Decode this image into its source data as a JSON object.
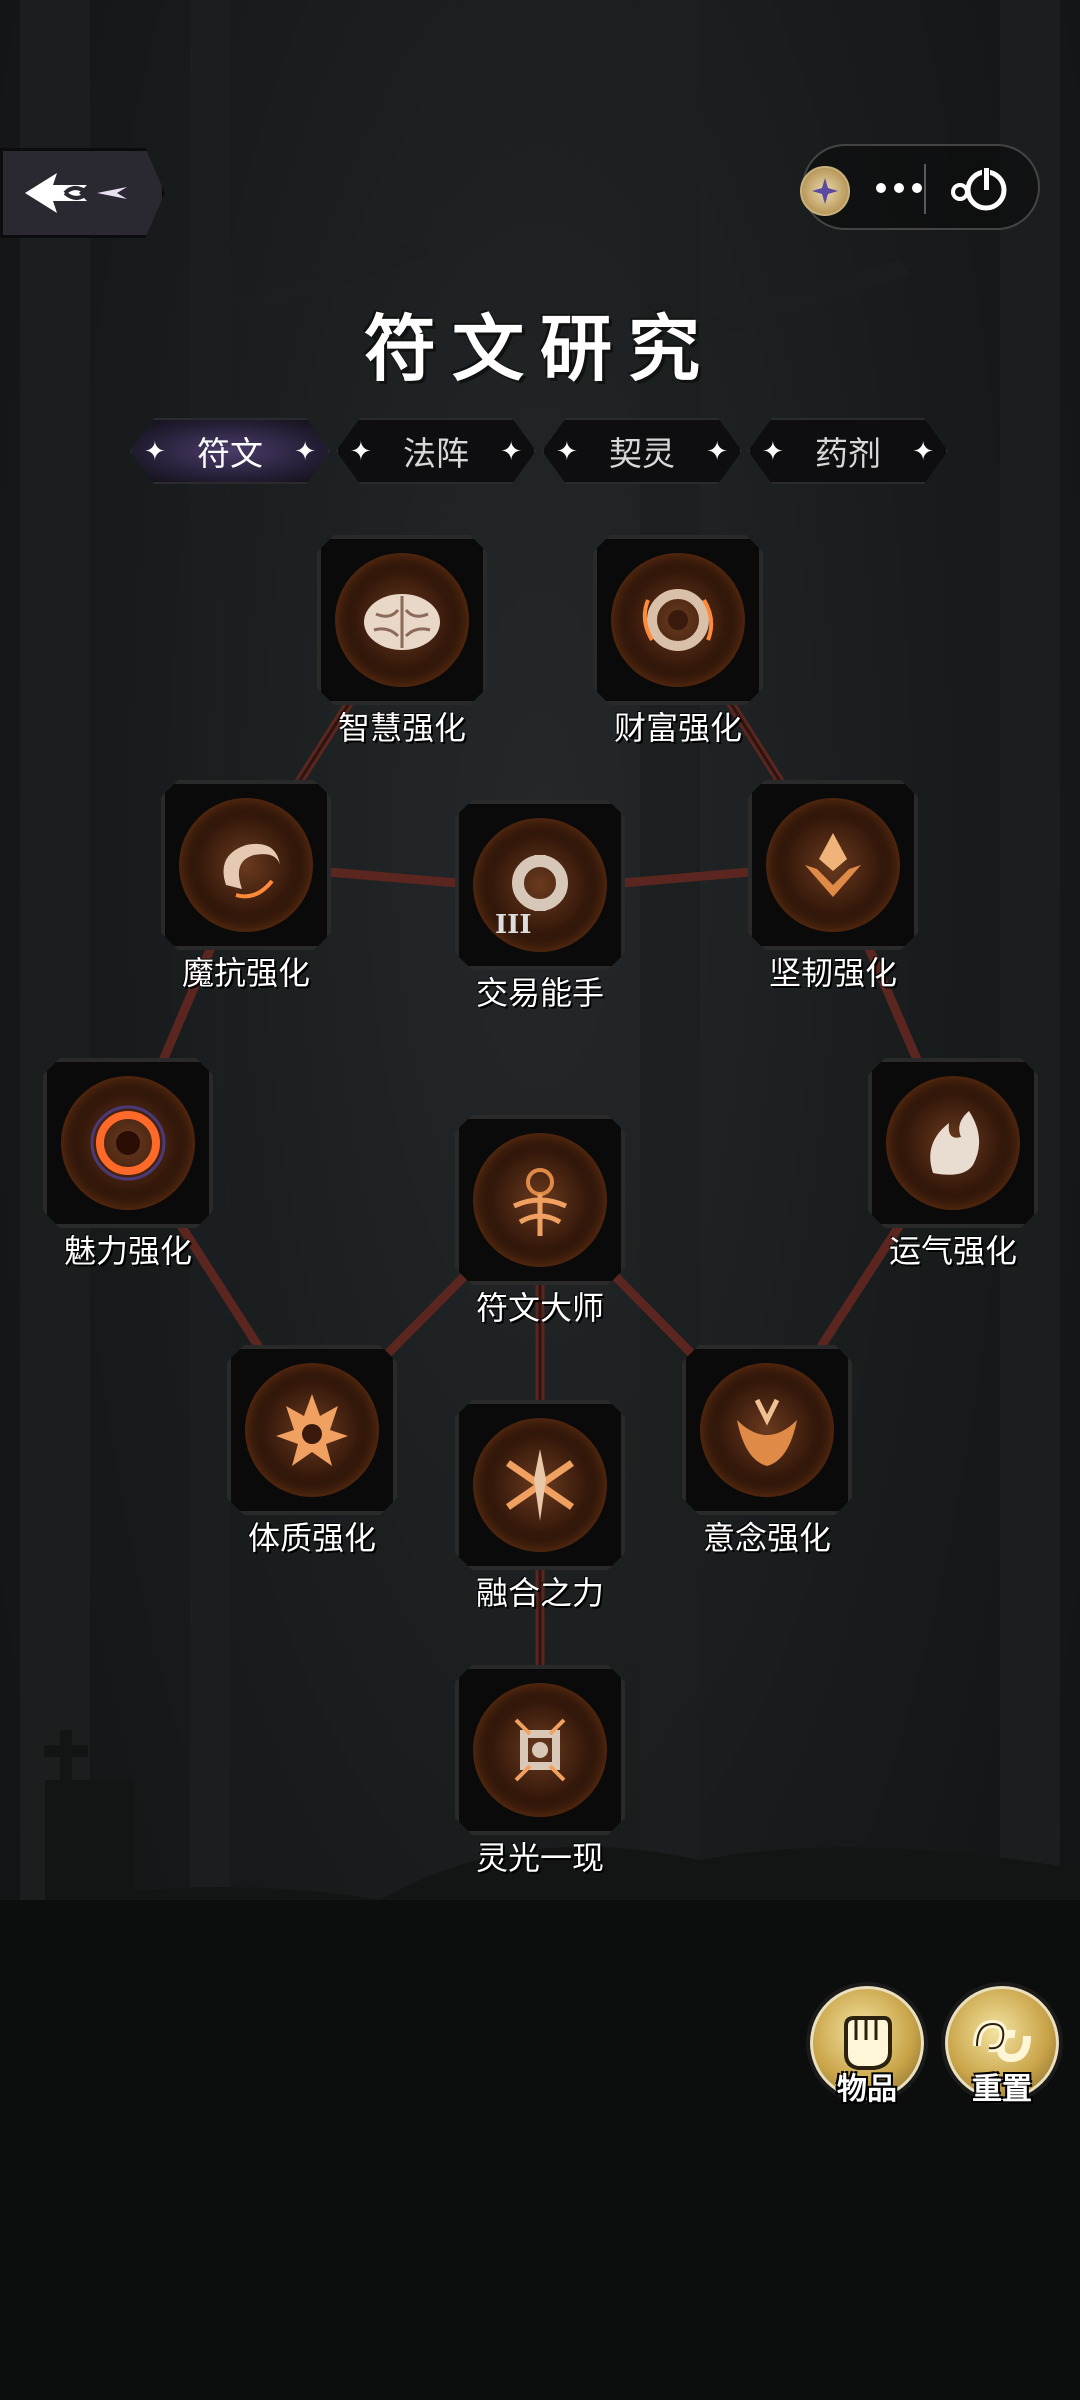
{
  "header": {
    "title": "符文研究",
    "back_icon": "back-arrow-icon",
    "capsule": {
      "more_icon": "more-dots-icon",
      "close_icon": "power-icon"
    }
  },
  "tabs": [
    {
      "label": "符文",
      "active": true
    },
    {
      "label": "法阵",
      "active": false
    },
    {
      "label": "契灵",
      "active": false
    },
    {
      "label": "药剂",
      "active": false
    }
  ],
  "tree": {
    "nodes": [
      {
        "id": "wisdom",
        "label": "智慧强化",
        "icon": "brain-icon"
      },
      {
        "id": "wealth",
        "label": "财富强化",
        "icon": "coin-ring-icon"
      },
      {
        "id": "magic_resist",
        "label": "魔抗强化",
        "icon": "swirl-icon"
      },
      {
        "id": "trade",
        "label": "交易能手",
        "icon": "trade-ring-icon",
        "rank": "III"
      },
      {
        "id": "tenacity",
        "label": "坚韧强化",
        "icon": "crest-icon"
      },
      {
        "id": "charm",
        "label": "魅力强化",
        "icon": "eye-orb-icon"
      },
      {
        "id": "rune_master",
        "label": "符文大师",
        "icon": "rune-sigil-icon"
      },
      {
        "id": "luck",
        "label": "运气强化",
        "icon": "spirit-flame-icon"
      },
      {
        "id": "constitution",
        "label": "体质强化",
        "icon": "flame-crown-icon"
      },
      {
        "id": "willpower",
        "label": "意念强化",
        "icon": "horned-mask-icon"
      },
      {
        "id": "fusion",
        "label": "融合之力",
        "icon": "cross-blades-icon"
      },
      {
        "id": "inspiration",
        "label": "灵光一现",
        "icon": "lantern-icon"
      }
    ],
    "line_color": "#5b2620"
  },
  "side_buttons": [
    {
      "label": "物品",
      "icon": "fist-icon"
    },
    {
      "label": "重置",
      "icon": "reset-loop-icon"
    }
  ],
  "colors": {
    "accent": "#c9a449",
    "active_tab": "#4b3c6a",
    "node_glow": "#ff7a2a"
  }
}
